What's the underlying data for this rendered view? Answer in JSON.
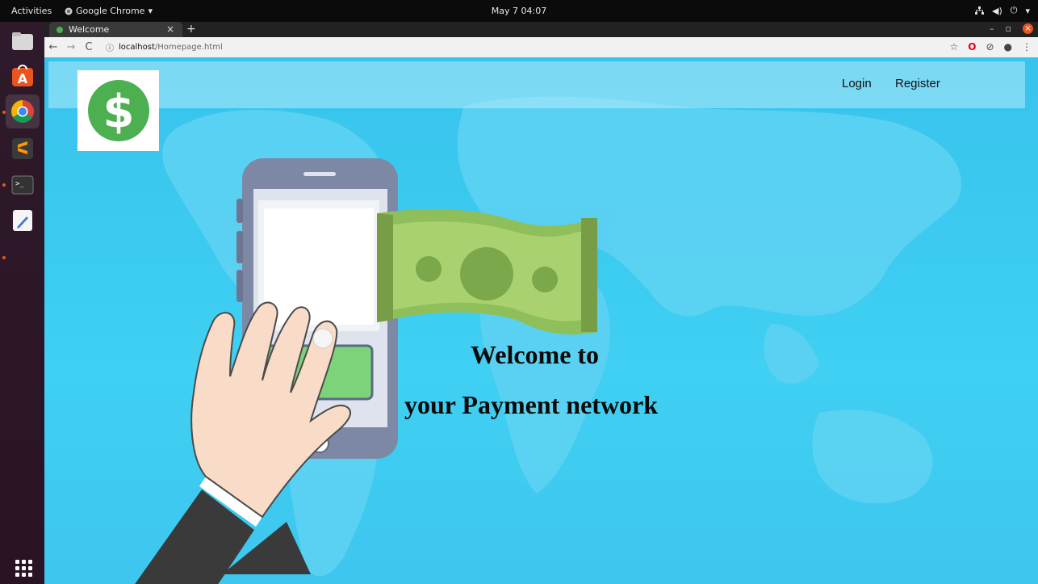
{
  "system": {
    "activities": "Activities",
    "app_name": "Google Chrome",
    "clock": "May 7  04:07"
  },
  "browser": {
    "tab_title": "Welcome",
    "url_host": "localhost",
    "url_path": "/Homepage.html"
  },
  "page": {
    "nav": {
      "login": "Login",
      "register": "Register"
    },
    "logo_symbol": "$",
    "heading_line1": "Welcome to",
    "heading_line2": "your Payment network"
  },
  "colors": {
    "page_bg": "#3fd0f3",
    "logo_green": "#4caf50",
    "bill_green": "#8fbf5a"
  }
}
